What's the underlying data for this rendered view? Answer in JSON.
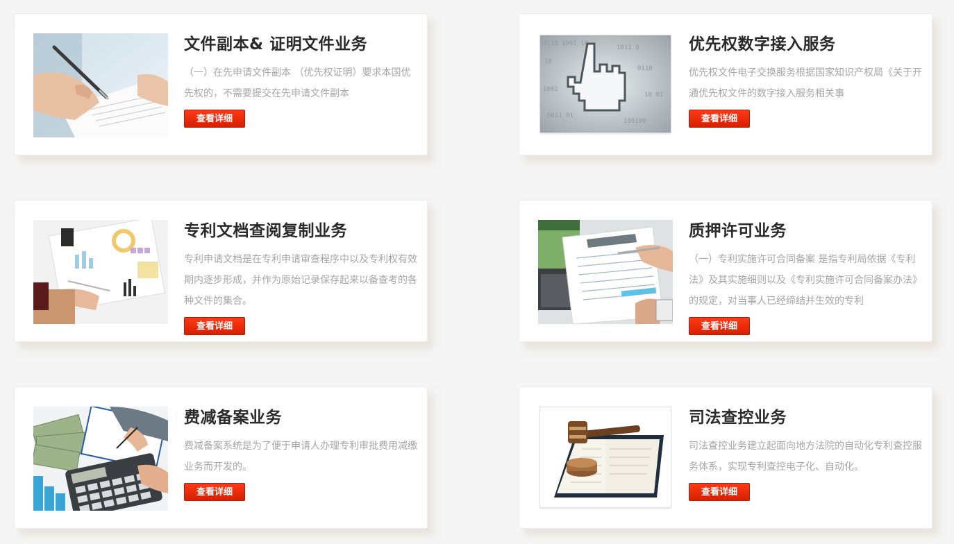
{
  "cards": [
    {
      "title": "文件副本& 证明文件业务",
      "desc": "（一）在先申请文件副本 （优先权证明）要求本国优先权的，不需要提交在先申请文件副本",
      "button": "查看详细",
      "image": "pen-signing-document-photo"
    },
    {
      "title": "优先权数字接入服务",
      "desc": "优先权文件电子交换服务根据国家知识产权局《关于开通优先权文件的数字接入服务相关事",
      "button": "查看详细",
      "image": "pixel-hand-cursor-binary-photo"
    },
    {
      "title": "专利文档查阅复制业务",
      "desc": "专利申请文档是在专利申请审查程序中以及专利权有效期内逐步形成，并作为原始记录保存起来以备查考的各种文件的集合。",
      "button": "查看详细",
      "image": "charts-on-desk-photo"
    },
    {
      "title": "质押许可业务",
      "desc": "（一）专利实施许可合同备案 是指专利局依据《专利法》及其实施细则以及《专利实施许可合同备案办法》的规定，对当事人已经缔结并生效的专利",
      "button": "查看详细",
      "image": "financial-report-pen-photo"
    },
    {
      "title": "费减备案业务",
      "desc": "费减备案系统是为了便于申请人办理专利审批费用减缴业务而开发的。",
      "button": "查看详细",
      "image": "calculator-money-photo"
    },
    {
      "title": "司法查控业务",
      "desc": "司法查控业务建立起面向地方法院的自动化专利查控服务体系，实现专利查控电子化、自动化。",
      "button": "查看详细",
      "image": "gavel-on-book-photo"
    }
  ]
}
